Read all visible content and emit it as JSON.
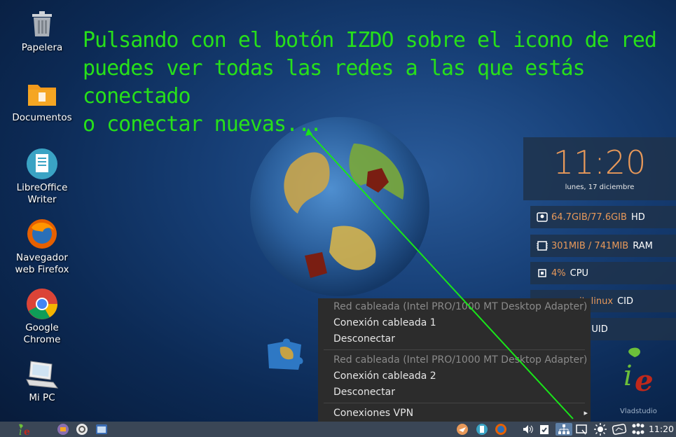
{
  "desktop_icons": [
    {
      "label": "Papelera",
      "icon": "trash-icon"
    },
    {
      "label": "Documentos",
      "icon": "folder-icon"
    },
    {
      "label": "LibreOffice Writer",
      "icon": "writer-icon"
    },
    {
      "label": "Navegador web Firefox",
      "icon": "firefox-icon"
    },
    {
      "label": "Google Chrome",
      "icon": "chrome-icon"
    },
    {
      "label": "Mi PC",
      "icon": "computer-icon"
    }
  ],
  "annotation": {
    "line1": "Pulsando con el botón IZDO sobre el icono de red",
    "line2": "puedes ver todas las redes a las que estás",
    "line3": "conectado",
    "line4": "o conectar nuevas...",
    "color": "#27e01a"
  },
  "conky": {
    "time": "11:20",
    "date": "lunes, 17 diciembre",
    "hd_value": "64.7GIB/77.6GIB",
    "hd_label": "HD",
    "ram_value": "301MIB / 741MIB",
    "ram_label": "RAM",
    "cpu_value": "4%",
    "cpu_label": "CPU",
    "cid_value": "italinux",
    "cid_label": "CID",
    "uid_value": "r",
    "uid_label": "UID"
  },
  "network_menu": {
    "section1_header": "Red cableada (Intel PRO/1000 MT Desktop Adapter)",
    "section1_conn": "Conexión cableada 1",
    "section1_disconnect": "Desconectar",
    "section2_header": "Red cableada (Intel PRO/1000 MT Desktop Adapter)",
    "section2_conn": "Conexión cableada 2",
    "section2_disconnect": "Desconectar",
    "vpn": "Conexiones VPN",
    "vpn_arrow": "▸"
  },
  "taskbar": {
    "clock": "11:20"
  },
  "wallpaper": {
    "watermark": "Vladstudio"
  },
  "colors": {
    "accent_orange": "#e8995a",
    "menu_bg": "#2c2c2c",
    "taskbar_bg": "#3a4656"
  }
}
